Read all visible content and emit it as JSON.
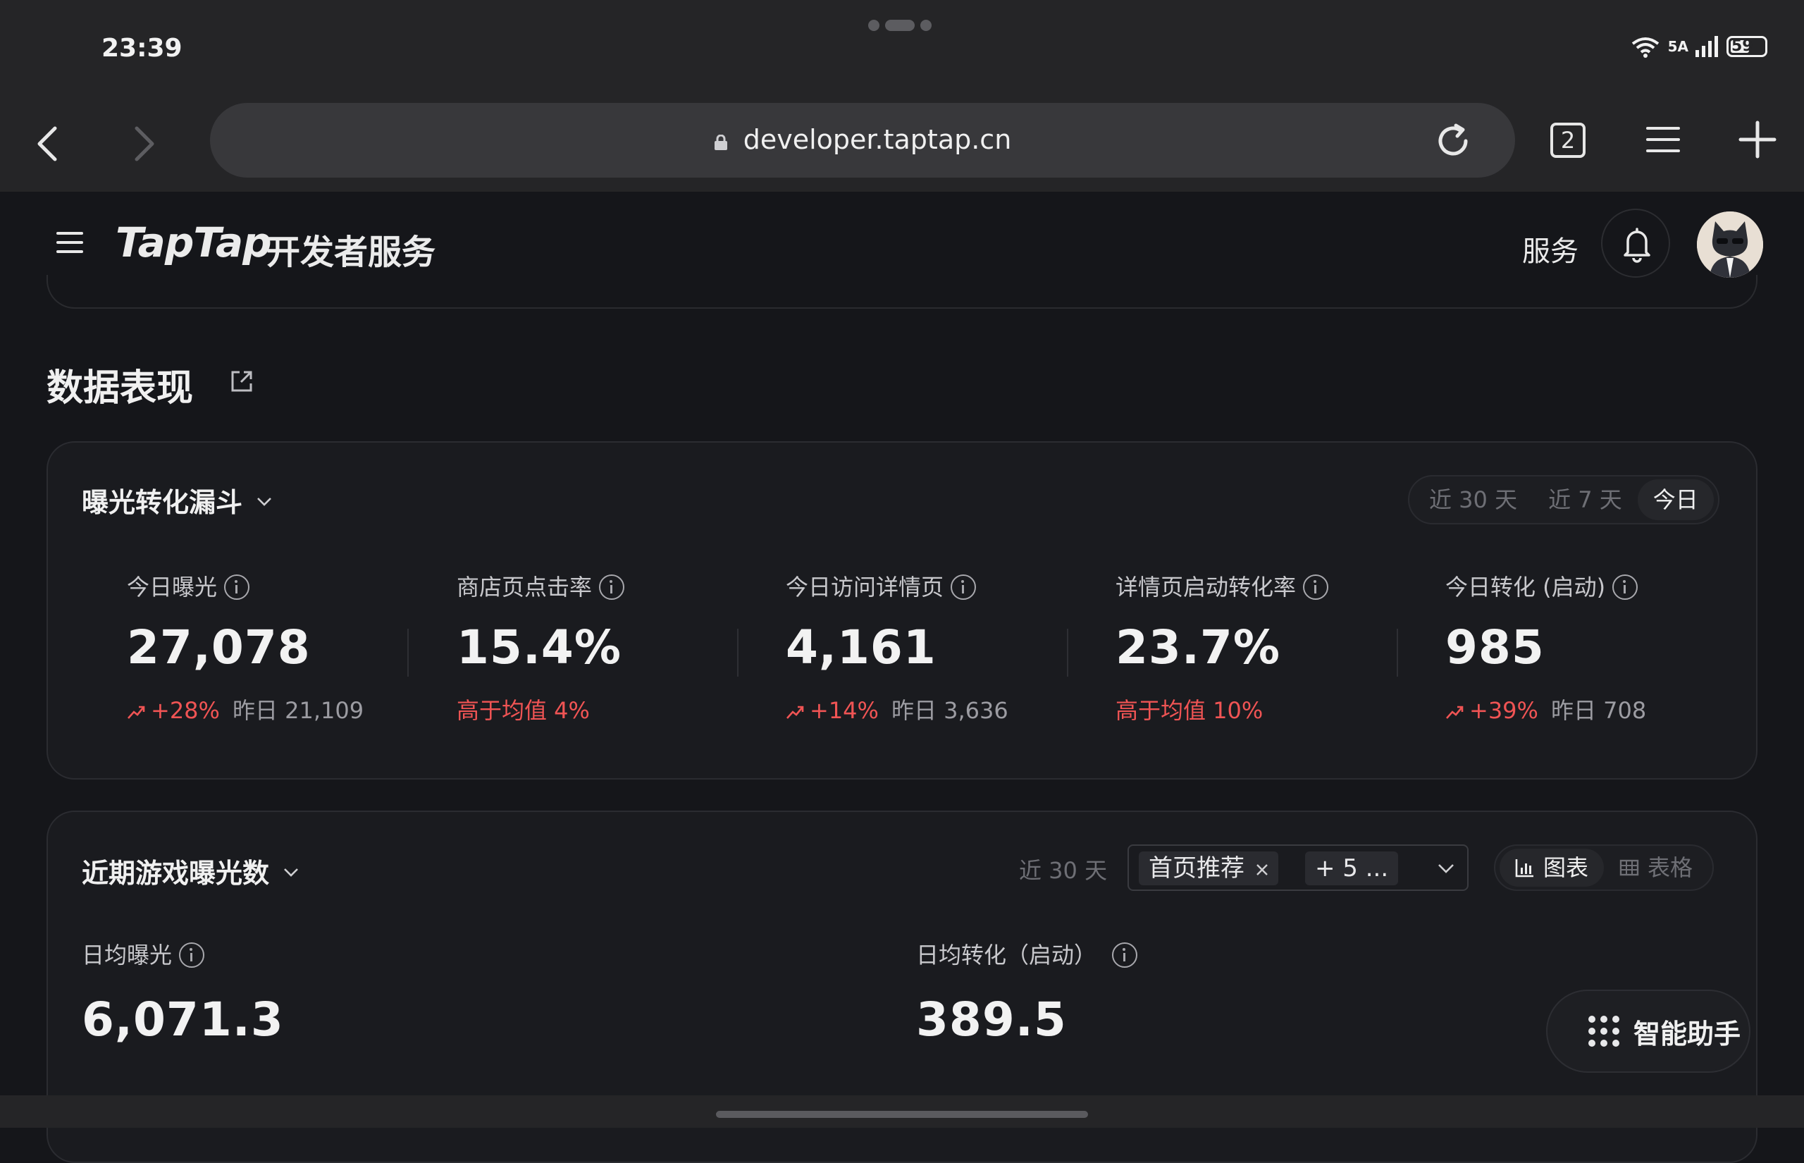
{
  "status": {
    "time": "23:39",
    "network": "5A",
    "battery": "59"
  },
  "browser": {
    "url": "developer.taptap.cn",
    "tab_count": "2"
  },
  "header": {
    "logo": "TapTap",
    "logo_sub": "开发者服务",
    "services": "服务"
  },
  "section": {
    "title": "数据表现"
  },
  "funnel": {
    "title": "曝光转化漏斗",
    "ranges": [
      "近 30 天",
      "近 7 天",
      "今日"
    ],
    "active_range": "今日",
    "metrics": [
      {
        "label": "今日曝光",
        "value": "27,078",
        "change": "+28%",
        "yesterday": "昨日 21,109"
      },
      {
        "label": "商店页点击率",
        "value": "15.4%",
        "note": "高于均值 4%"
      },
      {
        "label": "今日访问详情页",
        "value": "4,161",
        "change": "+14%",
        "yesterday": "昨日 3,636"
      },
      {
        "label": "详情页启动转化率",
        "value": "23.7%",
        "note": "高于均值 10%"
      },
      {
        "label": "今日转化 (启动)",
        "value": "985",
        "change": "+39%",
        "yesterday": "昨日 708"
      }
    ]
  },
  "exposure": {
    "title": "近期游戏曝光数",
    "range": "近 30 天",
    "filter_tags": [
      "首页推荐",
      "+ 5 ..."
    ],
    "view_modes": [
      "图表",
      "表格"
    ],
    "active_view": "图表",
    "avg_exposure_label": "日均曝光",
    "avg_exposure_value": "6,071.3",
    "avg_conversion_label": "日均转化（启动）",
    "avg_conversion_value": "389.5"
  },
  "assistant": {
    "label": "智能助手"
  },
  "colors": {
    "up": "#f05454",
    "background": "#15161a",
    "card": "#1a1b1f"
  }
}
